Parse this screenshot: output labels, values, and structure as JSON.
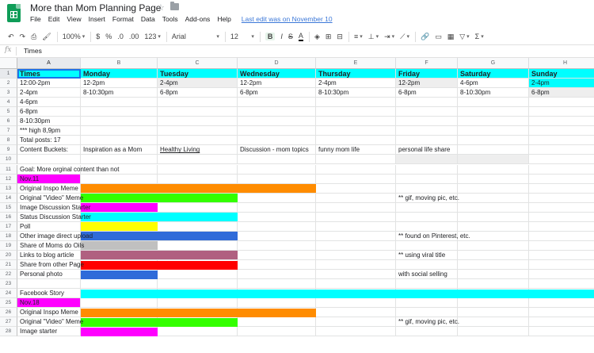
{
  "doc": {
    "title": "More than Mom Planning Page",
    "last_edit": "Last edit was on November 10"
  },
  "menu": [
    "File",
    "Edit",
    "View",
    "Insert",
    "Format",
    "Data",
    "Tools",
    "Add-ons",
    "Help"
  ],
  "toolbar": {
    "zoom": "100%",
    "currency": "$",
    "percent": "%",
    "dec_decrease": ".0",
    "dec_increase": ".00",
    "more_formats": "123",
    "font": "Arial",
    "font_size": "12",
    "bold": "B",
    "italic": "I",
    "strike": "S",
    "text_color": "A"
  },
  "formula": {
    "fx": "fx",
    "value": "Times"
  },
  "columns": [
    "A",
    "B",
    "C",
    "D",
    "E",
    "F",
    "G",
    "H"
  ],
  "rows": [
    "1",
    "2",
    "3",
    "4",
    "5",
    "6",
    "7",
    "8",
    "9",
    "10",
    "11",
    "12",
    "13",
    "14",
    "15",
    "16",
    "17",
    "18",
    "19",
    "20",
    "21",
    "22",
    "23",
    "24",
    "25",
    "26",
    "27",
    "28"
  ],
  "header_row": [
    "Times",
    "Monday",
    "Tuesday",
    "Wednesday",
    "Thursday",
    "Friday",
    "Saturday",
    "Sunday"
  ],
  "cells": {
    "A2": "12:00-2pm",
    "B2": "12-2pm",
    "C2": "2-4pm",
    "D2": "12-2pm",
    "E2": "2-4pm",
    "F2": "12-2pm",
    "G2": "4-6pm",
    "H2": "2-4pm",
    "A3": "2-4pm",
    "B3": "8-10:30pm",
    "C3": "6-8pm",
    "D3": "6-8pm",
    "E3": "8-10:30pm",
    "F3": "6-8pm",
    "G3": "8-10:30pm",
    "H3": "6-8pm",
    "A4": "4-6pm",
    "A5": "6-8pm",
    "A6": "8-10:30pm",
    "A7": "*** high 8,9pm",
    "A8": "Total posts: 17",
    "A9": "Content Buckets:",
    "B9": "Inspiration as a Mom",
    "C9": "Healthy Living",
    "D9": "Discussion - mom topics",
    "E9": "funny mom life",
    "F9": "personal life share",
    "A11": "Goal: More orginal content than not",
    "A12": "Nov.11",
    "A13": "Original Inspo Meme",
    "A14": "Original \"Video\" Meme",
    "F14": "** gif, moving pic, etc.",
    "A15": "Image Discussion Starter",
    "A16": "Status Discussion Starter",
    "A17": "Poll",
    "A18": "Other image direct upload",
    "F18": "** found on Pinterest, etc.",
    "A19": "Share of Moms do Oils",
    "A20": "Links to blog article",
    "F20": "** using viral title",
    "A21": "Share from other Page",
    "A22": "Personal photo",
    "F22": "with social selling",
    "A24": "Facebook Story",
    "A25": "Nov.18",
    "A26": "Original Inspo Meme",
    "A27": "Original \"Video\" Meme",
    "F27": "** gif, moving pic, etc.",
    "A28": "Image starter"
  },
  "colors": {
    "cyan": "#00ffff",
    "magenta": "#ff00ff",
    "orange": "#ff8c00",
    "green": "#33ff00",
    "yellow": "#ffff00",
    "blue": "#2f6bd9",
    "silver": "#c0c0c0",
    "mauve": "#b06080",
    "red": "#ff0000",
    "selection": "#1a73e8",
    "sheets_green": "#0f9d58"
  }
}
